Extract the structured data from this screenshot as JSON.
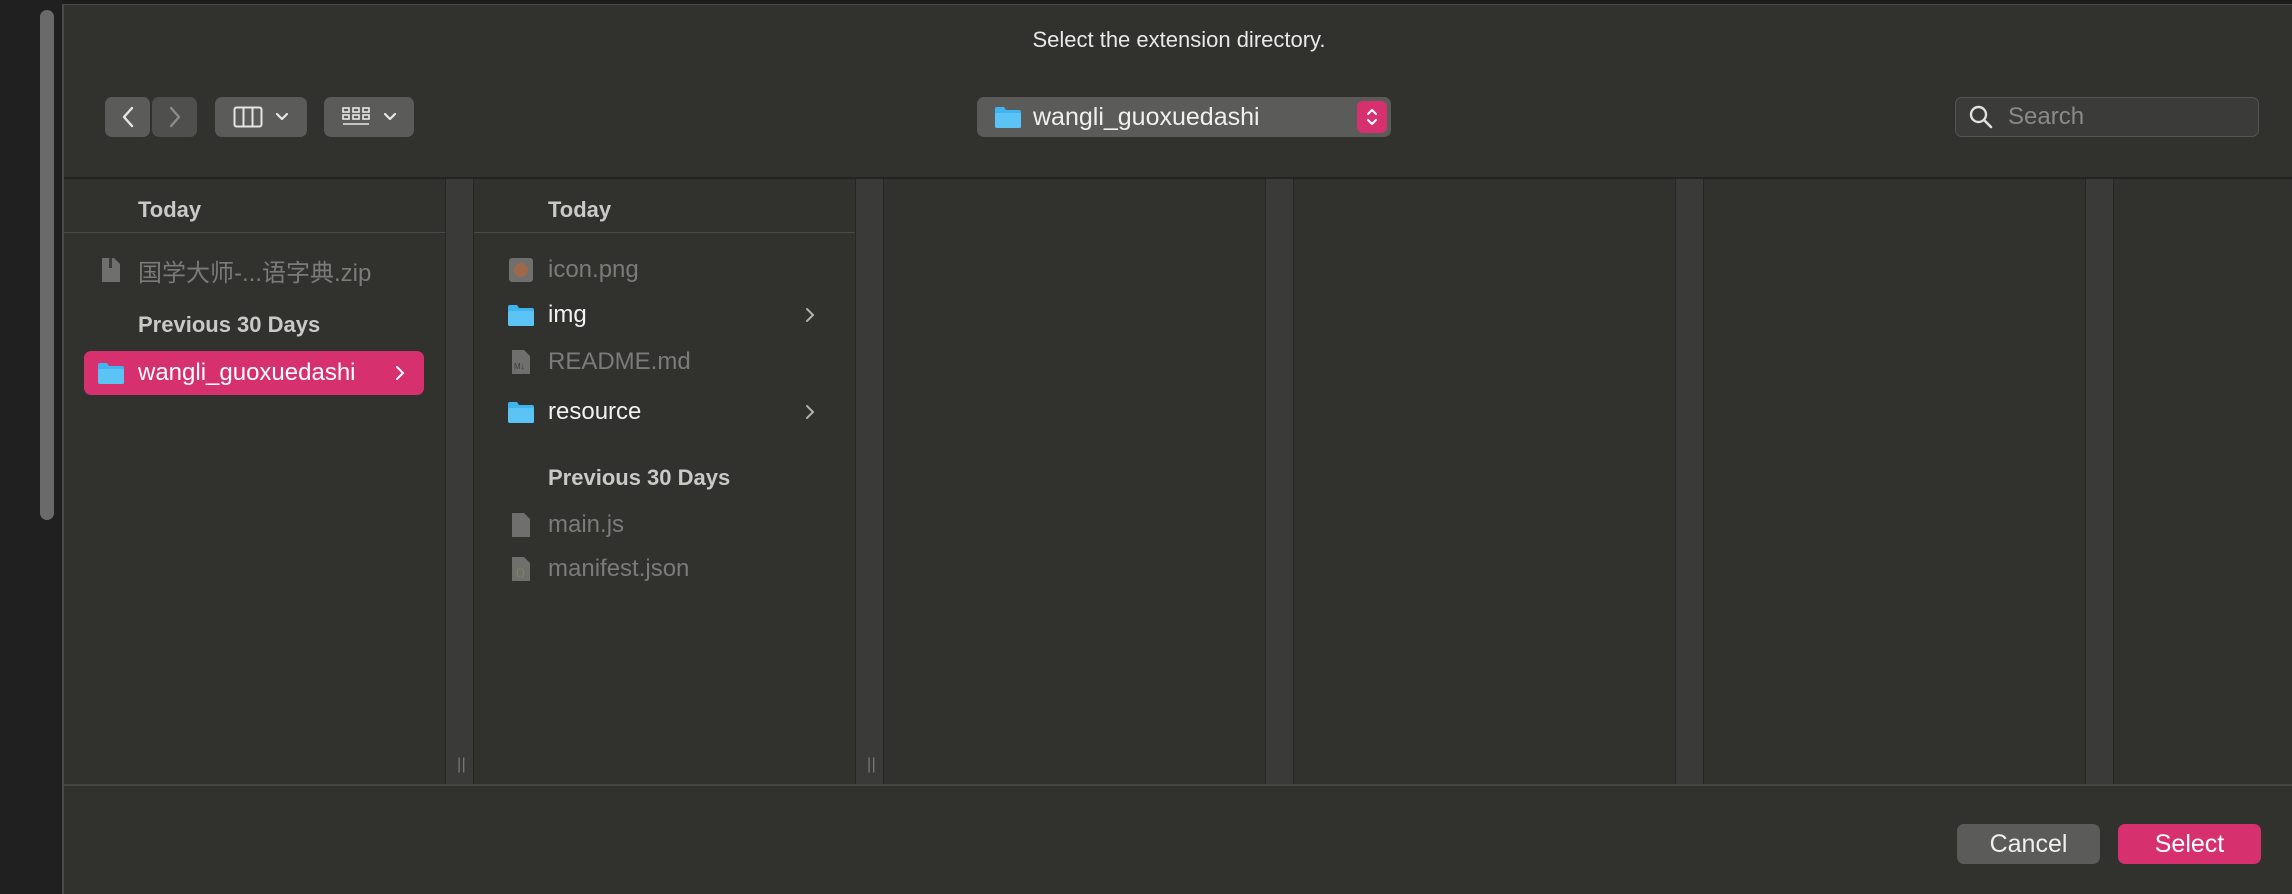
{
  "dialog": {
    "title": "Select the extension directory."
  },
  "toolbar": {
    "back_icon": "chevron-left-icon",
    "forward_icon": "chevron-right-icon",
    "view_icon": "column-view-icon",
    "group_icon": "grid-view-icon",
    "path_label": "wangli_guoxuedashi",
    "search_placeholder": "Search"
  },
  "column1": {
    "header": "Today",
    "section_previous": "Previous 30 Days",
    "items": [
      {
        "name": "国学大师-...语字典.zip",
        "icon": "zip-file-icon"
      },
      {
        "name": "wangli_guoxuedashi",
        "icon": "folder-icon",
        "selected": true
      }
    ]
  },
  "column2": {
    "header": "Today",
    "section_previous": "Previous 30 Days",
    "items": [
      {
        "name": "icon.png",
        "icon": "image-file-icon"
      },
      {
        "name": "img",
        "icon": "folder-icon"
      },
      {
        "name": "README.md",
        "icon": "markdown-file-icon"
      },
      {
        "name": "resource",
        "icon": "folder-icon"
      },
      {
        "name": "main.js",
        "icon": "file-icon"
      },
      {
        "name": "manifest.json",
        "icon": "json-file-icon"
      }
    ]
  },
  "footer": {
    "cancel_label": "Cancel",
    "select_label": "Select"
  },
  "colors": {
    "accent": "#d7306f",
    "folder": "#3fb4ee",
    "background": "#31312e"
  }
}
